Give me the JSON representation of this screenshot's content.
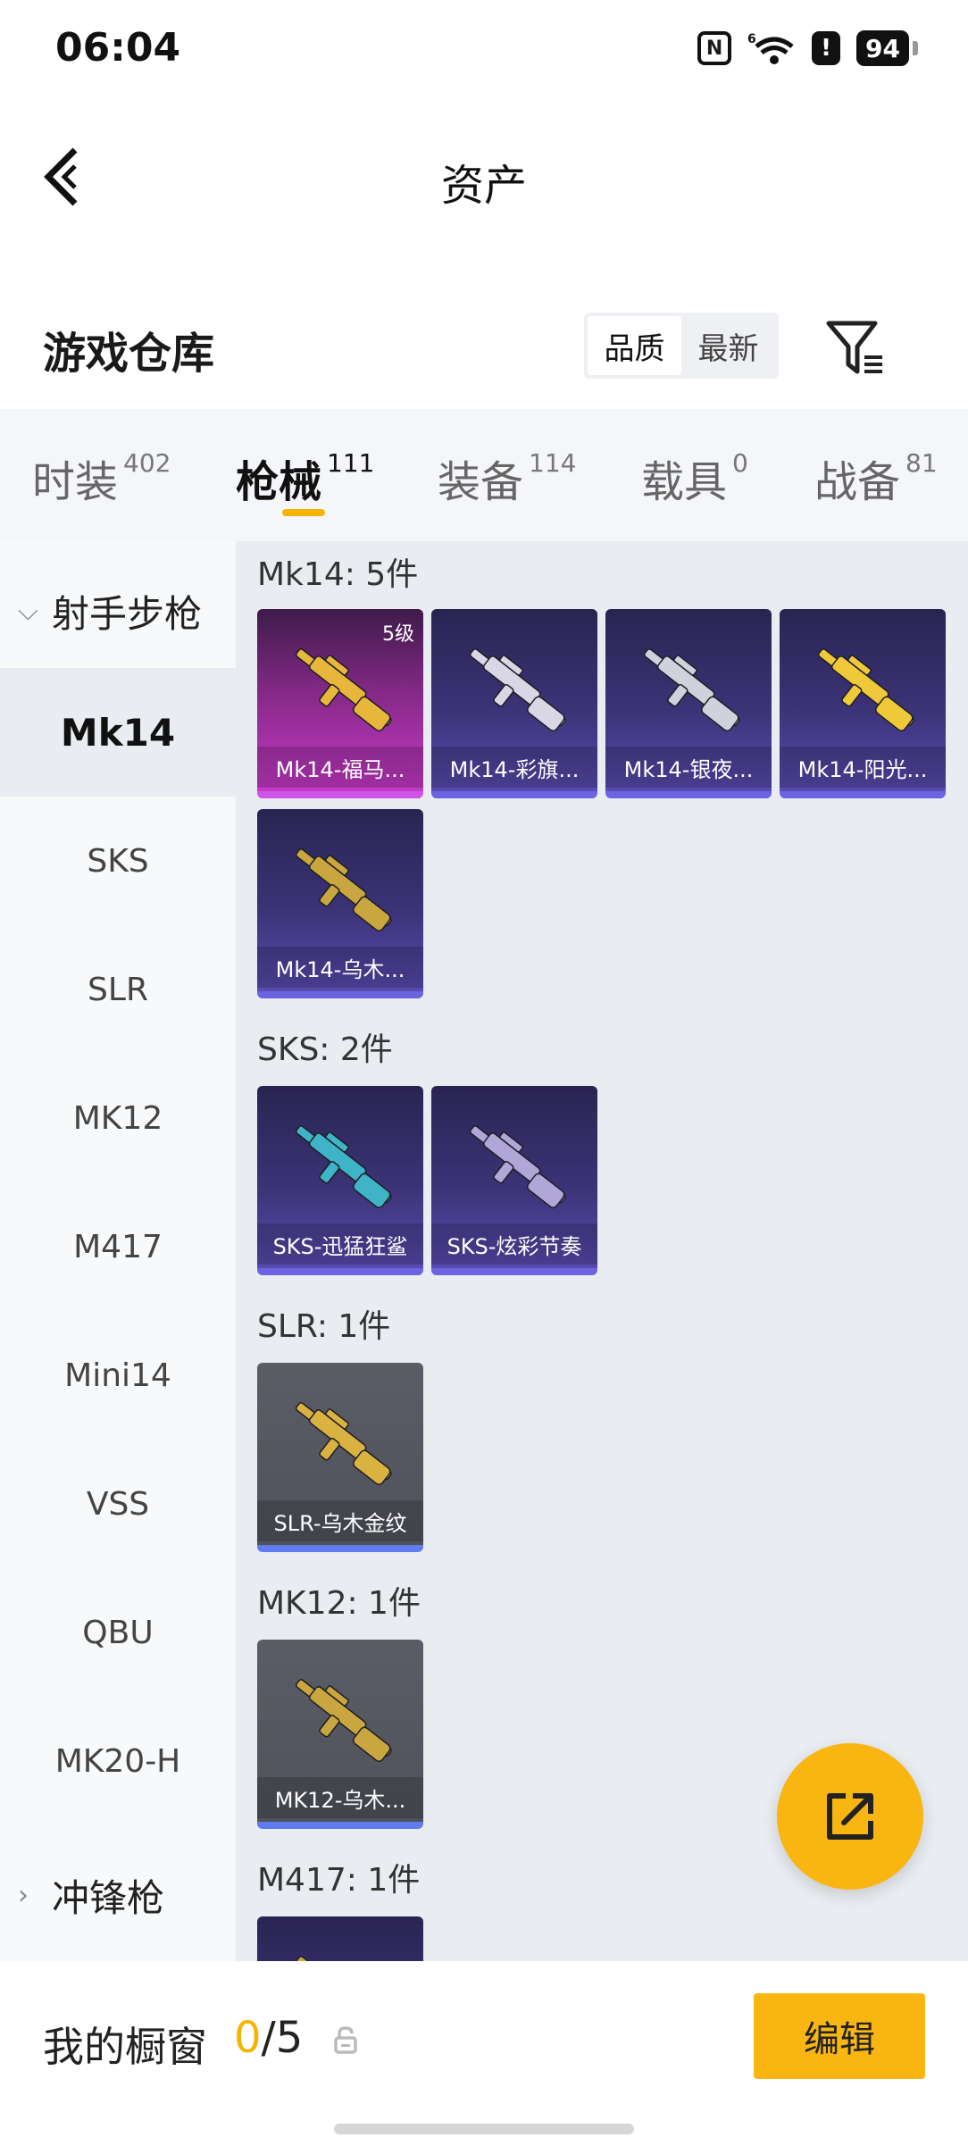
{
  "status_bar": {
    "time": "06:04",
    "nfc": "N",
    "network": "6",
    "alert": "!",
    "battery": "94"
  },
  "header": {
    "title": "资产",
    "back_icon": "chevron-left-icon"
  },
  "warehouse": {
    "title": "游戏仓库",
    "sort_options": [
      "品质",
      "最新"
    ],
    "sort_selected": "品质",
    "filter_icon": "filter-icon"
  },
  "tabs": [
    {
      "label": "时装",
      "count": "402"
    },
    {
      "label": "枪械",
      "count": "111",
      "active": true
    },
    {
      "label": "装备",
      "count": "114"
    },
    {
      "label": "载具",
      "count": "0"
    },
    {
      "label": "战备",
      "count": "81"
    }
  ],
  "sidebar": {
    "group_open": "射手步枪",
    "items": [
      "Mk14",
      "SKS",
      "SLR",
      "MK12",
      "M417",
      "Mini14",
      "VSS",
      "QBU",
      "MK20-H"
    ],
    "active_item": "Mk14",
    "group_closed": "冲锋枪"
  },
  "sections": [
    {
      "title": "Mk14: 5件",
      "items": [
        {
          "name": "Mk14-福马...",
          "level": "5级",
          "rarity": "magenta",
          "accent": "#e8b63a"
        },
        {
          "name": "Mk14-彩旗...",
          "rarity": "purple",
          "accent": "#d9d7e6"
        },
        {
          "name": "Mk14-银夜...",
          "rarity": "purple",
          "accent": "#cfd2dc"
        },
        {
          "name": "Mk14-阳光...",
          "rarity": "purple",
          "accent": "#f0c93a"
        },
        {
          "name": "Mk14-乌木...",
          "rarity": "purple",
          "accent": "#c9a640"
        }
      ]
    },
    {
      "title": "SKS: 2件",
      "items": [
        {
          "name": "SKS-迅猛狂鲨",
          "rarity": "purple",
          "accent": "#3fb3c8"
        },
        {
          "name": "SKS-炫彩节奏",
          "rarity": "purple",
          "accent": "#b0a6d8"
        }
      ]
    },
    {
      "title": "SLR: 1件",
      "items": [
        {
          "name": "SLR-乌木金纹",
          "rarity": "grey",
          "accent": "#d9b240"
        }
      ]
    },
    {
      "title": "MK12: 1件",
      "items": [
        {
          "name": "MK12-乌木...",
          "rarity": "grey",
          "accent": "#c9a640"
        }
      ]
    },
    {
      "title": "M417: 1件",
      "items": [
        {
          "name": "",
          "rarity": "purple",
          "accent": "#c9a640"
        }
      ]
    }
  ],
  "fab": {
    "icon": "share-external-icon"
  },
  "showcase": {
    "label": "我的橱窗",
    "current": "0",
    "total": "/5",
    "lock_icon": "lock-icon",
    "edit_label": "编辑"
  },
  "colors": {
    "accent": "#f9b510",
    "tab_indicator": "#f5b400"
  }
}
